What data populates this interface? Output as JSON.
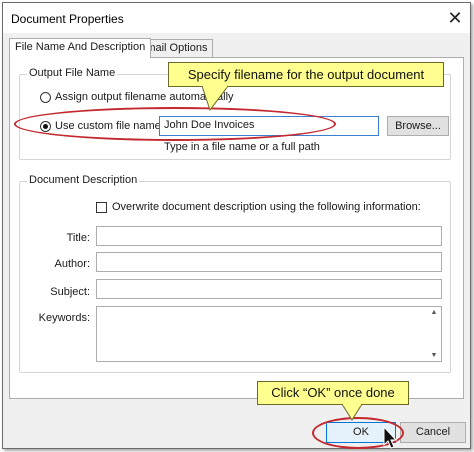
{
  "window": {
    "title": "Document Properties",
    "close_glyph": "✕"
  },
  "tabs": [
    {
      "label": "File Name And Description",
      "active": true
    },
    {
      "label": "Email Options",
      "active": false
    }
  ],
  "output_file": {
    "legend": "Output File Name",
    "auto_label": "Assign output filename automatically",
    "custom_label": "Use custom file name:",
    "custom_value": "John Doe Invoices",
    "browse_label": "Browse...",
    "hint": "Type in a file name or a full path"
  },
  "doc_description": {
    "legend": "Document Description",
    "overwrite_label": "Overwrite document description using the following information:",
    "title_label": "Title:",
    "author_label": "Author:",
    "subject_label": "Subject:",
    "keywords_label": "Keywords:"
  },
  "buttons": {
    "ok": "OK",
    "cancel": "Cancel"
  },
  "annotations": {
    "filename_callout": "Specify filename for the output document",
    "ok_callout": "Click “OK” once done",
    "highlight_color": "#c2282e",
    "callout_color": "#ffff8f"
  }
}
